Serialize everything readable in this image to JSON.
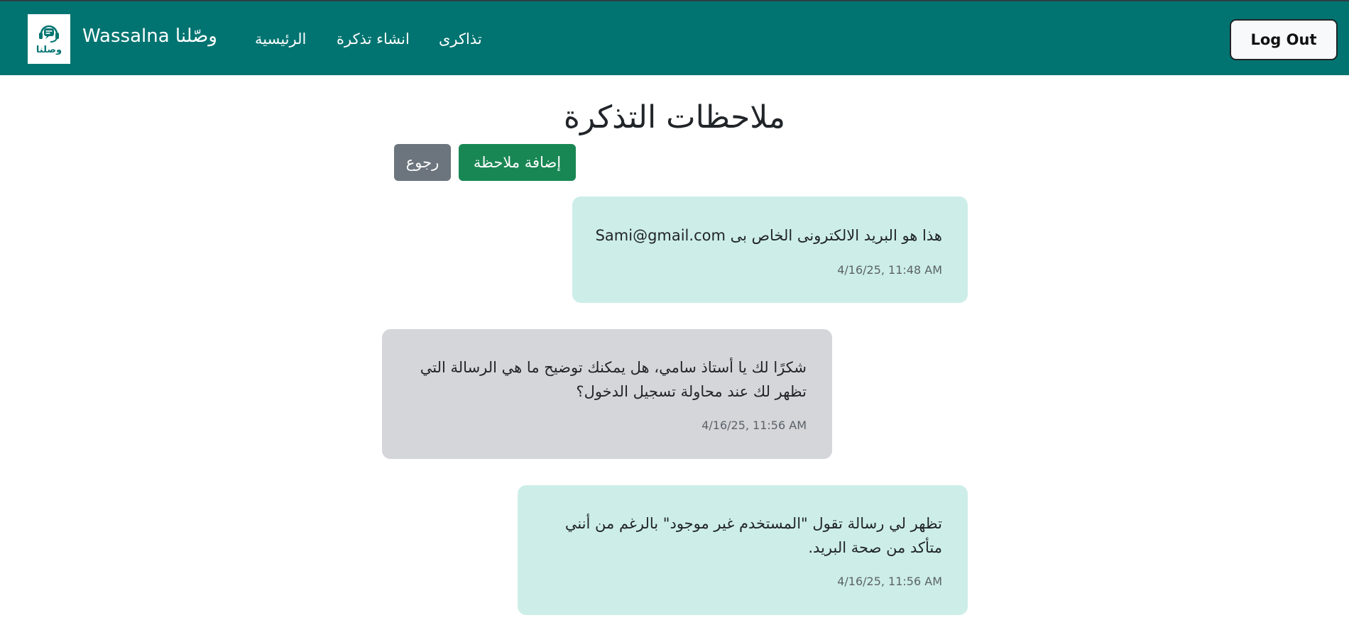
{
  "navbar": {
    "logo_text": "وصلنا",
    "brand": "Wassalna وصّلنا",
    "links": [
      "الرئيسية",
      "انشاء تذكرة",
      "تذاكرى"
    ],
    "logout_label": "Log Out",
    "background": "#017471"
  },
  "page": {
    "title": "ملاحظات التذكرة",
    "add_note_label": "إضافة ملاحظة",
    "back_label": "رجوع"
  },
  "notes": [
    {
      "text": "Sami@gmail.com هذا هو البريد الالكترونى الخاص بى",
      "time": "4/16/25, 11:48 AM",
      "side": "me"
    },
    {
      "text": "شكرًا لك يا أستاذ سامي، هل يمكنك توضيح ما هي الرسالة التي تظهر لك عند محاولة تسجيل الدخول؟",
      "time": "4/16/25, 11:56 AM",
      "side": "other"
    },
    {
      "text": "تظهر لي رسالة تقول \"المستخدم غير موجود\" بالرغم من أنني متأكد من صحة البريد.",
      "time": "4/16/25, 11:56 AM",
      "side": "me"
    }
  ],
  "colors": {
    "my_note": "#cdeee8",
    "other_note": "#d5d6da",
    "add_button": "#198754",
    "back_button": "#6c757d"
  },
  "icons": {
    "logo": "headset-chat-icon"
  }
}
